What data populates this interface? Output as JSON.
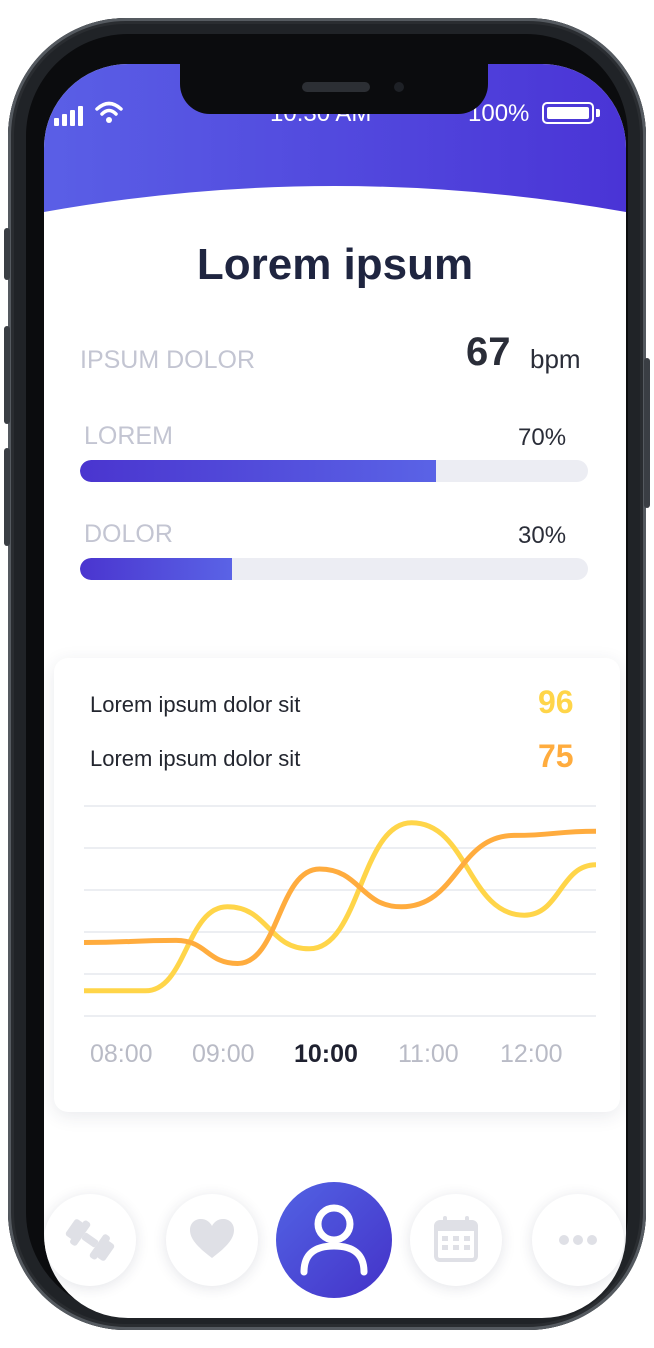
{
  "status_bar": {
    "time": "10:30 AM",
    "battery": "100%"
  },
  "header": {
    "title": "Lorem ipsum"
  },
  "metric": {
    "label": "IPSUM DOLOR",
    "value": "67",
    "unit": "bpm"
  },
  "progress": [
    {
      "label": "LOREM",
      "percent_text": "70%",
      "value": 0.7
    },
    {
      "label": "DOLOR",
      "percent_text": "30%",
      "value": 0.3
    }
  ],
  "card": {
    "legend": [
      {
        "label": "Lorem ipsum dolor sit",
        "value": "96",
        "color": "#ffd549"
      },
      {
        "label": "Lorem ipsum dolor sit",
        "value": "75",
        "color": "#ffac3e"
      }
    ]
  },
  "chart_data": {
    "type": "line",
    "x": [
      "08:00",
      "09:00",
      "10:00",
      "11:00",
      "12:00"
    ],
    "active_x": "10:00",
    "grid": true,
    "series": [
      {
        "color": "#ffd549",
        "points": [
          [
            0.0,
            0.12
          ],
          [
            0.12,
            0.12
          ],
          [
            0.28,
            0.52
          ],
          [
            0.44,
            0.32
          ],
          [
            0.64,
            0.92
          ],
          [
            0.86,
            0.48
          ],
          [
            1.0,
            0.72
          ]
        ]
      },
      {
        "color": "#ffac3e",
        "points": [
          [
            0.0,
            0.35
          ],
          [
            0.18,
            0.36
          ],
          [
            0.3,
            0.25
          ],
          [
            0.46,
            0.7
          ],
          [
            0.62,
            0.52
          ],
          [
            0.84,
            0.86
          ],
          [
            1.0,
            0.88
          ]
        ]
      }
    ]
  },
  "nav": {
    "items": [
      {
        "icon": "dumbbell-icon"
      },
      {
        "icon": "heart-icon"
      },
      {
        "icon": "user-icon",
        "active": true
      },
      {
        "icon": "calendar-icon"
      },
      {
        "icon": "more-icon"
      }
    ]
  }
}
